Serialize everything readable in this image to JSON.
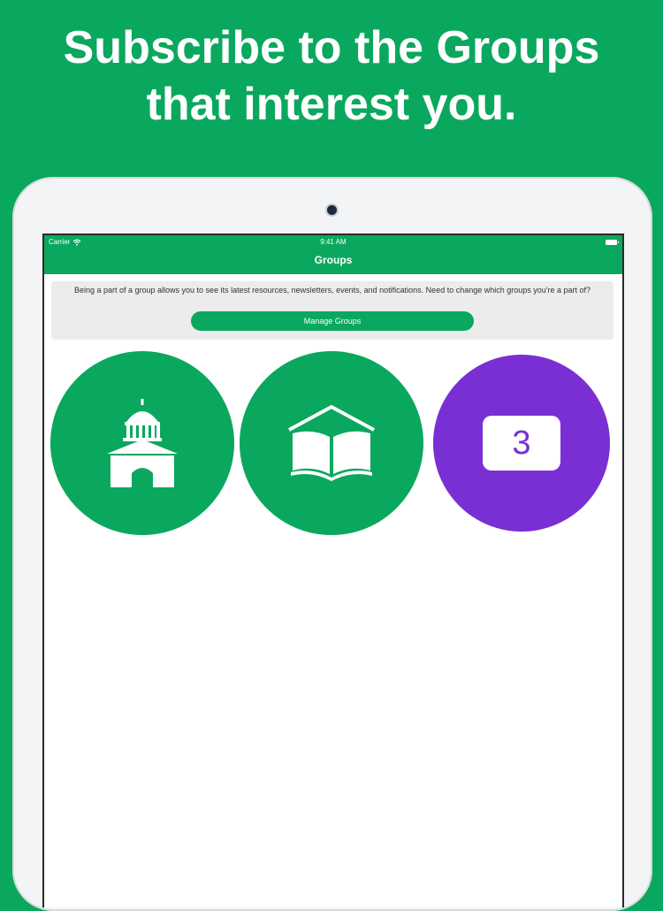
{
  "promo": {
    "headline_line1": "Subscribe to the Groups",
    "headline_line2": "that interest you."
  },
  "status_bar": {
    "carrier": "Carrier",
    "time": "9:41 AM"
  },
  "nav": {
    "title": "Groups"
  },
  "banner": {
    "text": "Being a part of a group allows you to see its latest resources, newsletters, events, and notifications. Need to change which groups you're a part of?",
    "button_label": "Manage Groups"
  },
  "groups": [
    {
      "icon": "courthouse-icon",
      "color": "#0aa85e"
    },
    {
      "icon": "open-book-icon",
      "color": "#0aa85e"
    },
    {
      "icon": "calendar-icon",
      "color": "#7a2fd4",
      "label": "3"
    }
  ],
  "colors": {
    "brand_green": "#0aa85e",
    "accent_purple": "#7a2fd4"
  }
}
